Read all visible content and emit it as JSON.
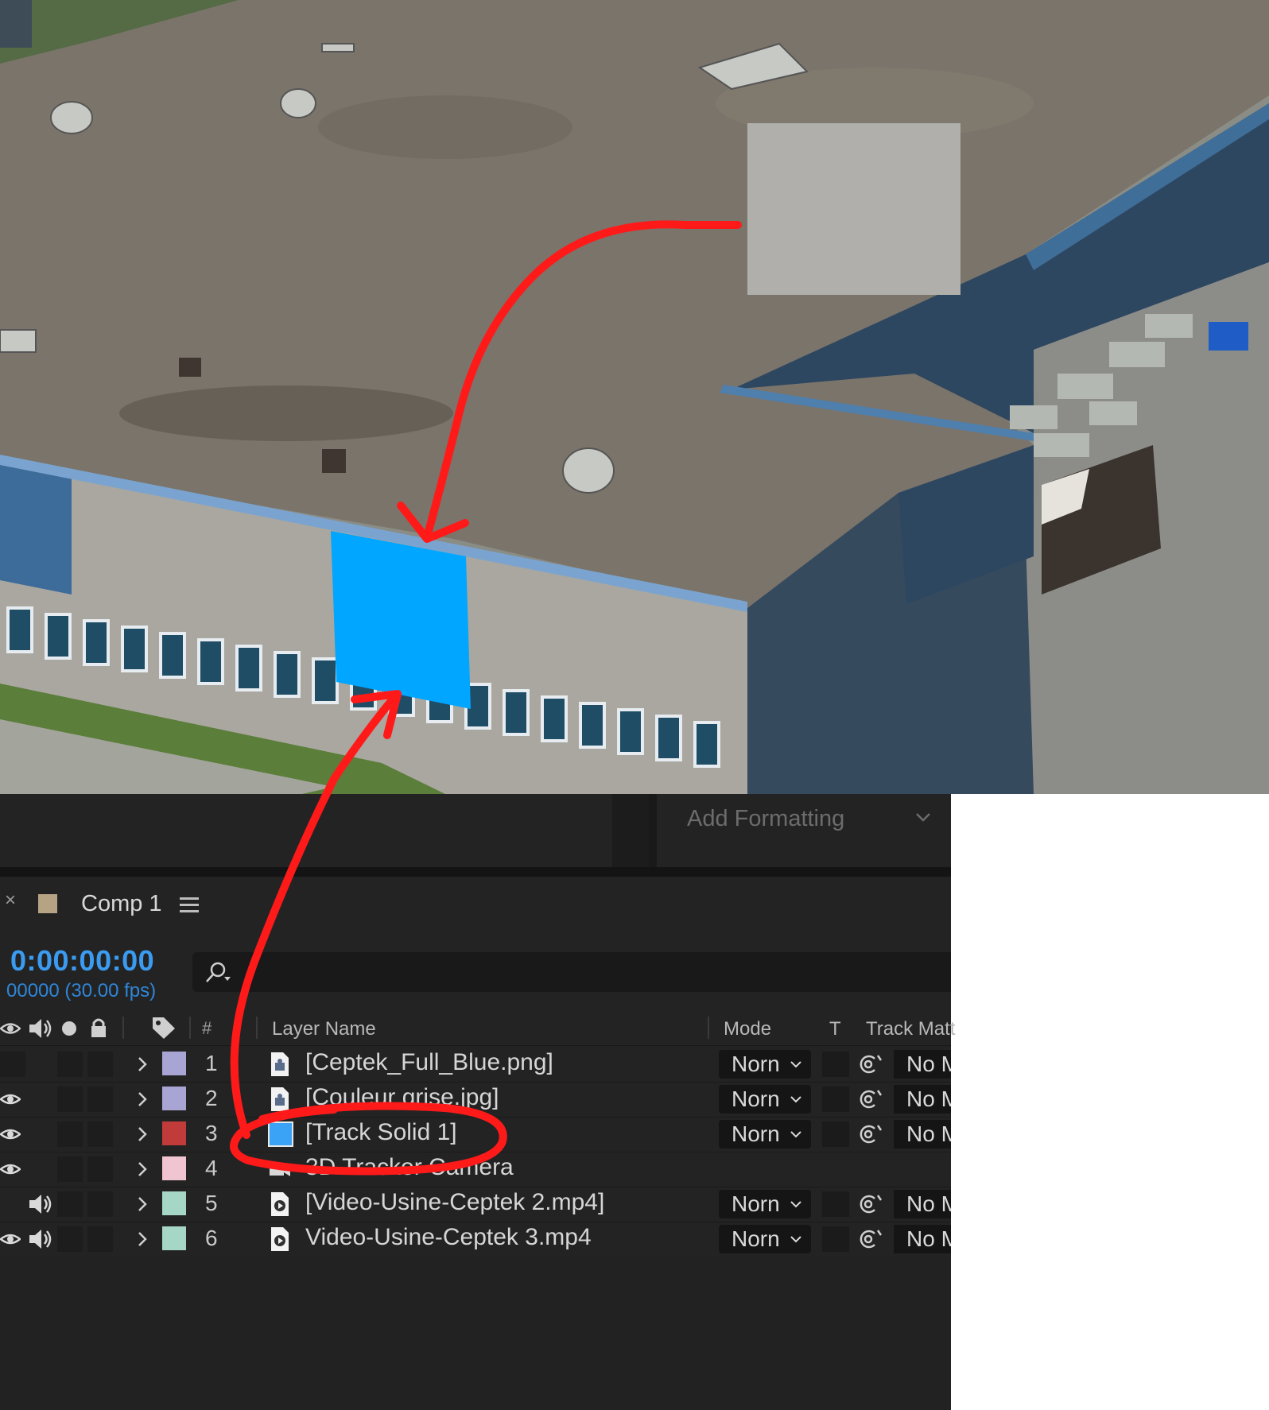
{
  "top_panel": {
    "add_formatting": "Add Formatting"
  },
  "composition": {
    "tab_title": "Comp 1",
    "tab_swatch_color": "#b6a383",
    "timecode": "0:00:00:00",
    "frames": "00000 (30.00 fps)"
  },
  "columns": {
    "number": "#",
    "layer_name": "Layer Name",
    "mode": "Mode",
    "t": "T",
    "track_matte": "Track Matt"
  },
  "layers": [
    {
      "num": "1",
      "name": "[Ceptek_Full_Blue.png]",
      "label_color": "#a8a4d4",
      "type": "image-file-icon",
      "mode": "Norn",
      "matte": "No M",
      "eye": false,
      "audio": false
    },
    {
      "num": "2",
      "name": "[Couleur grise.jpg]",
      "label_color": "#a8a4d4",
      "type": "image-file-icon",
      "mode": "Norn",
      "matte": "No M",
      "eye": true,
      "audio": false
    },
    {
      "num": "3",
      "name": "[Track Solid 1]",
      "label_color": "#c13b3b",
      "type": "solid-swatch",
      "solid_color": "#3aa3f5",
      "mode": "Norn",
      "matte": "No M",
      "eye": true,
      "audio": false
    },
    {
      "num": "4",
      "name": "3D Tracker Camera",
      "label_color": "#f0c4d0",
      "type": "camera-icon",
      "eye": true,
      "audio": false
    },
    {
      "num": "5",
      "name": "[Video-Usine-Ceptek 2.mp4]",
      "label_color": "#a6d6c6",
      "type": "video-file-icon",
      "mode": "Norn",
      "matte": "No M",
      "eye": false,
      "audio": true
    },
    {
      "num": "6",
      "name": "Video-Usine-Ceptek 3.mp4",
      "label_color": "#a6d6c6",
      "type": "video-file-icon",
      "mode": "Norn",
      "matte": "No M",
      "eye": true,
      "audio": true
    }
  ],
  "colors": {
    "timecode": "#3b9bf0",
    "annotation": "#ff1a1a",
    "tracked_solid": "#00a6ff",
    "placeholder_square": "#b0afab"
  }
}
